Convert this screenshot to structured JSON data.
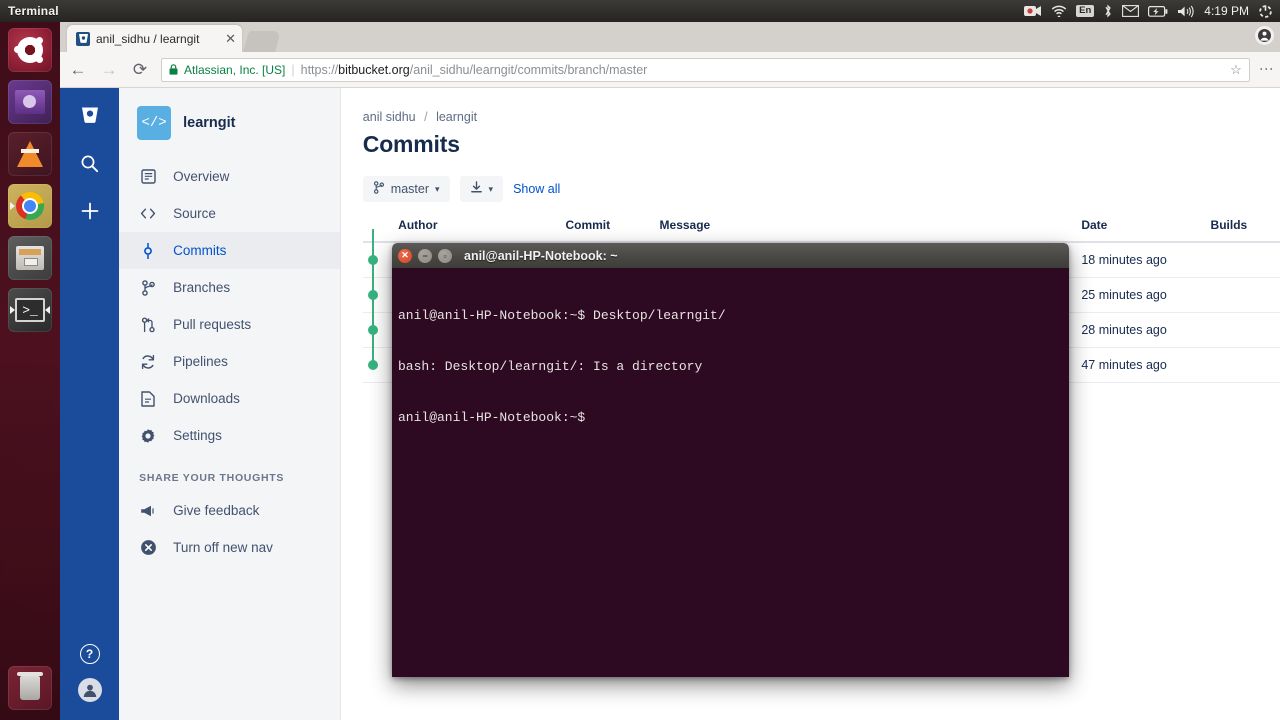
{
  "top_panel": {
    "app_name": "Terminal",
    "tray": {
      "record_icon": "record-camera-icon",
      "wifi_icon": "wifi-icon",
      "keyboard_layout": "En",
      "bluetooth_icon": "bluetooth-icon",
      "mail_icon": "envelope-icon",
      "battery_icon": "battery-charging-icon",
      "volume_icon": "volume-icon",
      "clock": "4:19 PM",
      "power_icon": "power-gear-icon"
    }
  },
  "launcher": {
    "items": [
      {
        "name": "ubuntu-dash",
        "icon": "ubuntu-logo-icon"
      },
      {
        "name": "amazon",
        "icon": "amazon-icon"
      },
      {
        "name": "vlc",
        "icon": "vlc-cone-icon"
      },
      {
        "name": "chrome",
        "icon": "chrome-icon"
      },
      {
        "name": "files",
        "icon": "file-manager-icon"
      },
      {
        "name": "terminal",
        "icon": "terminal-icon"
      }
    ],
    "trash": {
      "name": "trash",
      "icon": "trash-icon"
    }
  },
  "browser": {
    "tab": {
      "title": "anil_sidhu / learngit",
      "favicon": "bitbucket-icon",
      "close_icon": "close-icon"
    },
    "new_tab_icon": "new-tab-icon",
    "profile_icon": "profile-avatar-icon",
    "menu_icon": "chrome-menu-icon",
    "toolbar": {
      "back_icon": "back-arrow-icon",
      "forward_icon": "forward-arrow-icon",
      "reload_icon": "reload-icon",
      "lock_icon": "lock-icon",
      "site_identity": "Atlassian, Inc. [US]",
      "url_scheme": "https://",
      "url_host": "bitbucket.org",
      "url_path": "/anil_sidhu/learngit/commits/branch/master",
      "bookmark_icon": "star-icon"
    }
  },
  "bitbucket": {
    "rail": {
      "logo_icon": "bitbucket-logo-icon",
      "search_icon": "search-icon",
      "create_icon": "plus-icon",
      "help_icon": "help-icon",
      "avatar_icon": "user-avatar-icon"
    },
    "sidebar": {
      "repo_avatar_glyph": "</>",
      "repo_name": "learngit",
      "items": [
        {
          "label": "Overview",
          "icon": "overview-icon",
          "active": false
        },
        {
          "label": "Source",
          "icon": "code-brackets-icon",
          "active": false
        },
        {
          "label": "Commits",
          "icon": "commit-node-icon",
          "active": true
        },
        {
          "label": "Branches",
          "icon": "branch-icon",
          "active": false
        },
        {
          "label": "Pull requests",
          "icon": "pull-request-icon",
          "active": false
        },
        {
          "label": "Pipelines",
          "icon": "pipelines-refresh-icon",
          "active": false
        },
        {
          "label": "Downloads",
          "icon": "download-file-icon",
          "active": false
        },
        {
          "label": "Settings",
          "icon": "gear-icon",
          "active": false
        }
      ],
      "section_title": "SHARE YOUR THOUGHTS",
      "secondary_items": [
        {
          "label": "Give feedback",
          "icon": "megaphone-icon"
        },
        {
          "label": "Turn off new nav",
          "icon": "close-circle-icon"
        }
      ]
    },
    "main": {
      "breadcrumb": {
        "owner": "anil sidhu",
        "separator": "/",
        "repo": "learngit"
      },
      "page_title": "Commits",
      "toolbar": {
        "branch_icon": "branch-icon",
        "branch_label": "master",
        "branch_caret": "▾",
        "download_icon": "download-icon",
        "download_caret": "▾",
        "show_all_label": "Show all"
      },
      "table": {
        "headers": [
          "Author",
          "Commit",
          "Message",
          "Date",
          "Builds"
        ],
        "rows": [
          {
            "author": "",
            "commit": "",
            "message": "",
            "date": "18 minutes ago",
            "builds": ""
          },
          {
            "author": "",
            "commit": "",
            "message": "",
            "date": "25 minutes ago",
            "builds": ""
          },
          {
            "author": "",
            "commit": "",
            "message": "",
            "date": "28 minutes ago",
            "builds": ""
          },
          {
            "author": "",
            "commit": "",
            "message": "",
            "date": "47 minutes ago",
            "builds": ""
          }
        ]
      }
    }
  },
  "terminal": {
    "title": "anil@anil-HP-Notebook: ~",
    "close_icon": "window-close-icon",
    "minimize_icon": "window-minimize-icon",
    "maximize_icon": "window-maximize-icon",
    "lines": [
      "anil@anil-HP-Notebook:~$ Desktop/learngit/",
      "bash: Desktop/learngit/: Is a directory",
      "anil@anil-HP-Notebook:~$"
    ]
  },
  "colors": {
    "bitbucket_blue": "#1b4b9b",
    "link_blue": "#0052cc",
    "graph_green": "#36b37e",
    "terminal_bg": "#2d0922",
    "repo_avatar": "#59afe1"
  }
}
